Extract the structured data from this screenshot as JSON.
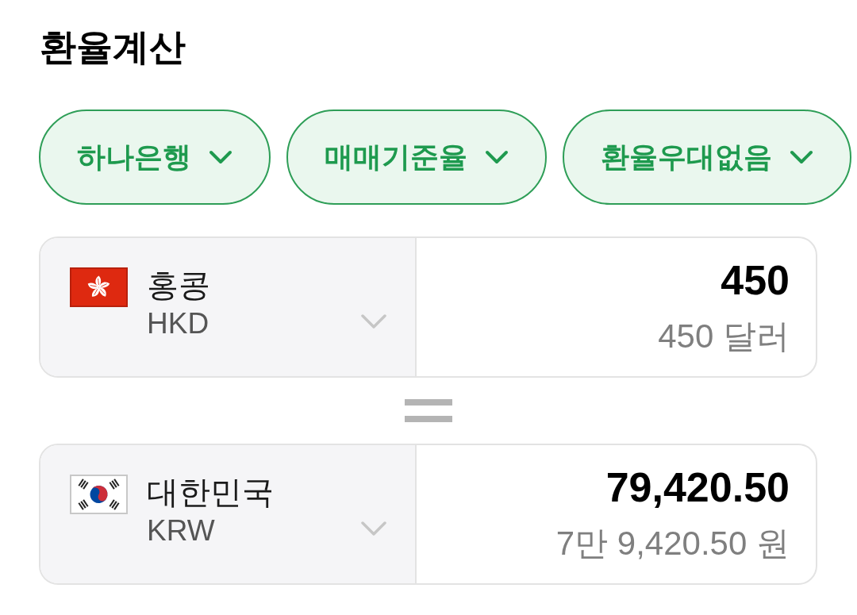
{
  "title": "환율계산",
  "filters": [
    {
      "label": "하나은행"
    },
    {
      "label": "매매기준율"
    },
    {
      "label": "환율우대없음"
    }
  ],
  "currencies": [
    {
      "name": "홍콩",
      "code": "HKD",
      "amount": "450",
      "amount_words": "450 달러"
    },
    {
      "name": "대한민국",
      "code": "KRW",
      "amount": "79,420.50",
      "amount_words": "7만 9,420.50 원"
    }
  ]
}
